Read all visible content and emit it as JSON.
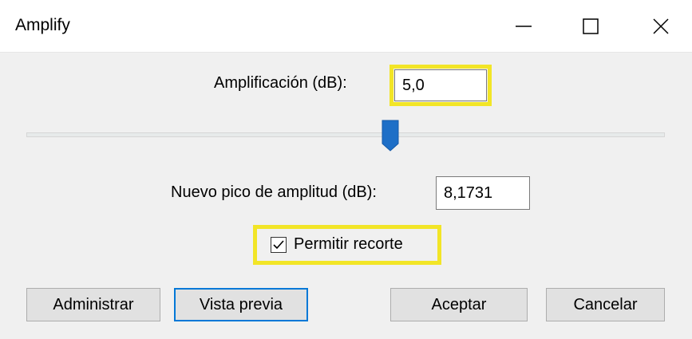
{
  "window": {
    "title": "Amplify",
    "controls": {
      "minimize_icon": "minimize-icon",
      "maximize_icon": "maximize-icon",
      "close_icon": "close-icon"
    }
  },
  "amplification": {
    "label": "Amplificación (dB):",
    "value": "5,0"
  },
  "slider": {
    "value_fraction": 0.57
  },
  "peak": {
    "label": "Nuevo pico de amplitud (dB):",
    "value": "8,1731"
  },
  "clipping": {
    "label": "Permitir recorte",
    "checked": true
  },
  "buttons": {
    "manage": "Administrar",
    "preview": "Vista previa",
    "ok": "Aceptar",
    "cancel": "Cancelar"
  },
  "colors": {
    "highlight": "#f2e527",
    "accent": "#0078d7",
    "slider_thumb": "#1e6fc7"
  }
}
